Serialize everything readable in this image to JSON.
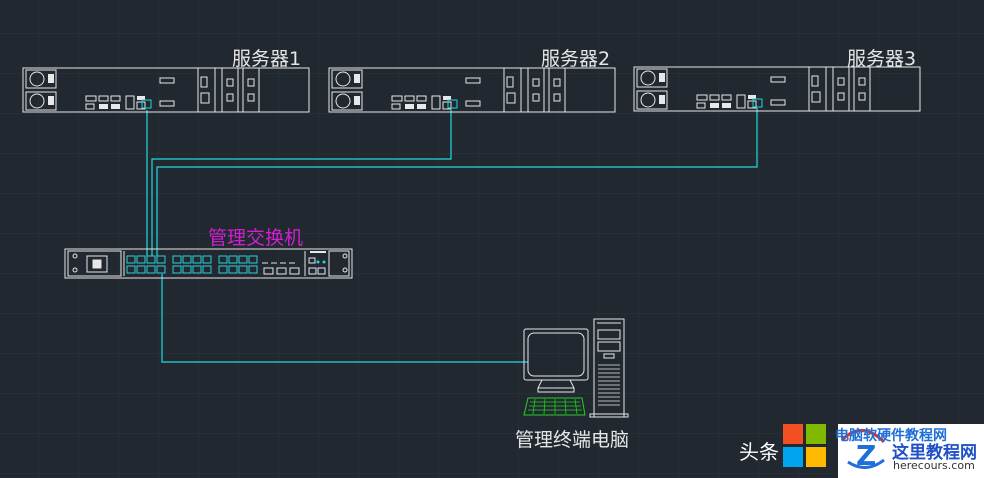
{
  "servers": [
    {
      "label": "服务器1"
    },
    {
      "label": "服务器2"
    },
    {
      "label": "服务器3"
    }
  ],
  "switch": {
    "label": "管理交换机"
  },
  "terminal": {
    "label": "管理终端电脑"
  },
  "watermark": {
    "prefix": "头条",
    "site_name": "这里教程网",
    "site_url": "herecours.com",
    "overlay_text": "电脑软硬件教程网"
  },
  "colors": {
    "background": "#212830",
    "grid": "#2c343d",
    "device_line": "#e8e8e8",
    "cable": "#20d8e0",
    "switch_port": "#2fd0d8",
    "switch_label": "#d21ed2",
    "keyboard": "#25d025"
  }
}
